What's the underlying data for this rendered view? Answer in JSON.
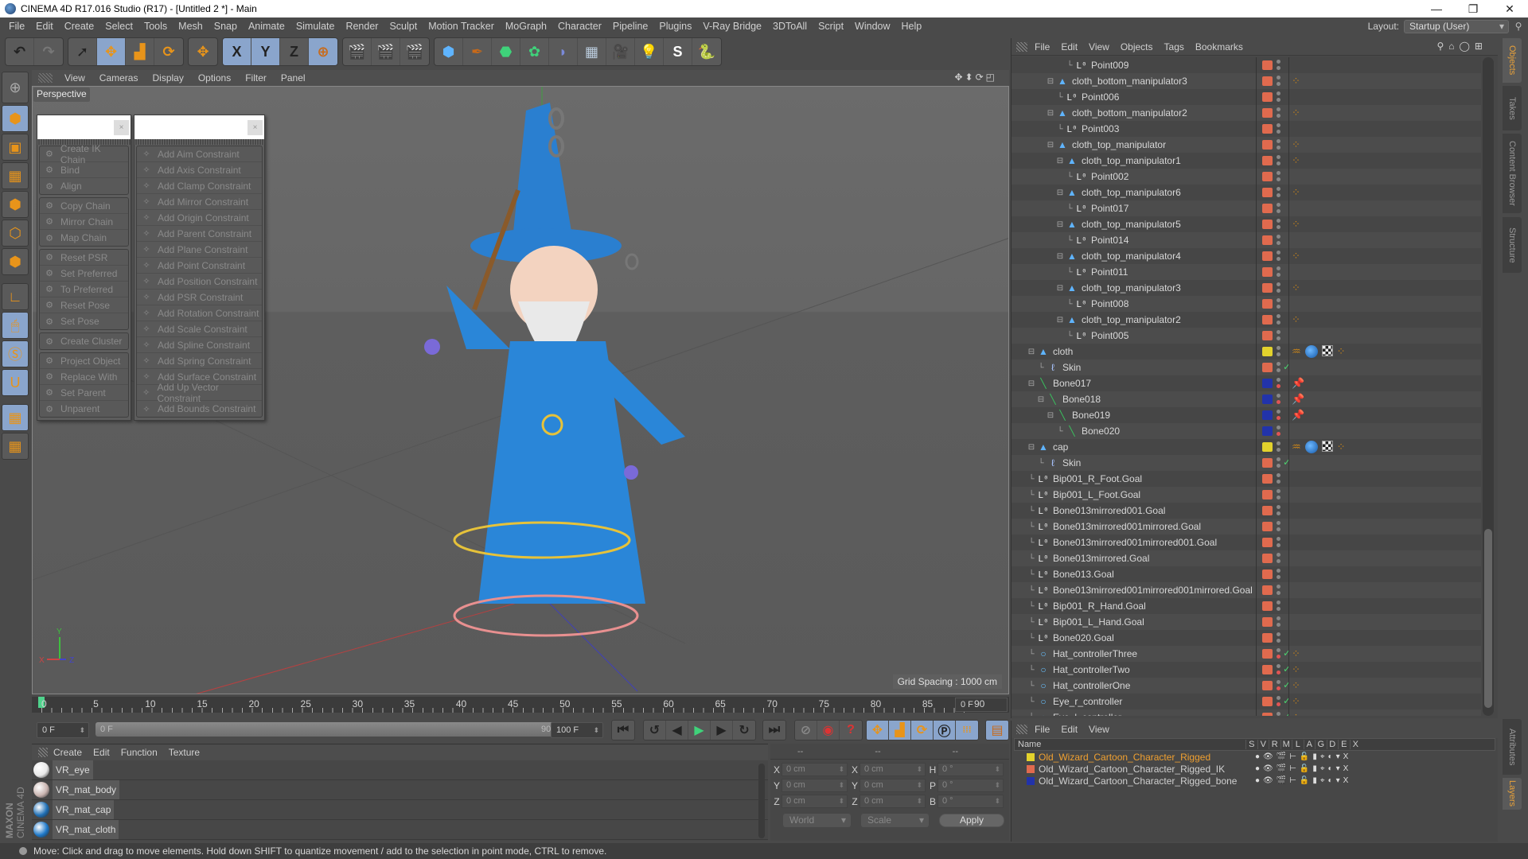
{
  "window": {
    "title": "CINEMA 4D R17.016 Studio (R17) - [Untitled 2 *] - Main",
    "controls": [
      "minimize-icon",
      "restore-icon",
      "close-icon"
    ]
  },
  "menubar": {
    "items": [
      "File",
      "Edit",
      "Create",
      "Select",
      "Tools",
      "Mesh",
      "Snap",
      "Animate",
      "Simulate",
      "Render",
      "Sculpt",
      "Motion Tracker",
      "MoGraph",
      "Character",
      "Pipeline",
      "Plugins",
      "V-Ray Bridge",
      "3DToAll",
      "Script",
      "Window",
      "Help"
    ],
    "layout_label": "Layout:",
    "layout_value": "Startup (User)"
  },
  "toolbar": {
    "groups": [
      [
        "undo-icon",
        "redo-icon"
      ],
      [
        "select-icon",
        "move-icon",
        "scale-icon",
        "rotate-icon"
      ],
      [
        "recent-tool-icon"
      ],
      [
        "x-axis-icon",
        "y-axis-icon",
        "z-axis-icon",
        "coordinate-system-icon"
      ],
      [
        "render-view-icon",
        "render-picture-viewer-icon",
        "render-settings-icon"
      ],
      [
        "cube-primitive-icon",
        "pen-spline-icon",
        "subdivision-icon",
        "array-icon",
        "deformer-icon",
        "floor-icon",
        "camera-icon",
        "light-icon",
        "vray-icon",
        "python-icon"
      ]
    ],
    "glyphs": [
      "↶",
      "↷",
      "➚",
      "✥",
      "▟",
      "⟳",
      "✥",
      "X",
      "Y",
      "Z",
      "⊕",
      "🎬",
      "🎬",
      "🎬",
      "⬢",
      "✒",
      "⬣",
      "✿",
      "◗",
      "▦",
      "🎥",
      "💡",
      "S",
      "🐍"
    ]
  },
  "left_tools": [
    "make-editable-icon",
    "model-mode-icon",
    "texture-mode-icon",
    "workplane-icon",
    "points-mode-icon",
    "edges-mode-icon",
    "polygons-mode-icon",
    "axis-mode-icon",
    "tweak-mode-icon",
    "solo-icon",
    "snap-icon",
    "workplane-lock-icon",
    "workplane-align-icon"
  ],
  "viewport": {
    "menu": [
      "View",
      "Cameras",
      "Display",
      "Options",
      "Filter",
      "Panel"
    ],
    "label": "Perspective",
    "grid_spacing": "Grid Spacing : 1000 cm",
    "axes": {
      "x": "X",
      "y": "Y",
      "z": "Z"
    }
  },
  "character_menu": {
    "groups": [
      [
        "Create IK Chain",
        "Bind",
        "Align"
      ],
      [
        "Copy Chain",
        "Mirror Chain",
        "Map Chain"
      ],
      [
        "Reset PSR",
        "Set Preferred",
        "To Preferred",
        "Reset Pose",
        "Set Pose"
      ],
      [
        "Create Cluster"
      ],
      [
        "Project Object",
        "Replace With",
        "Set Parent",
        "Unparent"
      ]
    ]
  },
  "constraint_menu": {
    "items": [
      "Add Aim Constraint",
      "Add Axis Constraint",
      "Add Clamp Constraint",
      "Add Mirror Constraint",
      "Add Origin Constraint",
      "Add Parent Constraint",
      "Add Plane Constraint",
      "Add Point Constraint",
      "Add Position Constraint",
      "Add PSR Constraint",
      "Add Rotation Constraint",
      "Add Scale Constraint",
      "Add Spline Constraint",
      "Add Spring Constraint",
      "Add Surface Constraint",
      "Add Up Vector Constraint",
      "Add Bounds Constraint"
    ]
  },
  "timeline": {
    "ticks": [
      "0",
      "5",
      "10",
      "15",
      "20",
      "25",
      "30",
      "35",
      "40",
      "45",
      "50",
      "55",
      "60",
      "65",
      "70",
      "75",
      "80",
      "85",
      "90"
    ],
    "current_frame": "0 F",
    "start_field": "0 F",
    "range_start": "0 F",
    "range_end": "90 F",
    "end_field": "100 F",
    "current_frame_position": 0
  },
  "playback": {
    "buttons": [
      "go-to-start-icon",
      "previous-key-icon",
      "previous-frame-icon",
      "play-icon",
      "next-frame-icon",
      "next-key-icon",
      "go-to-end-icon"
    ],
    "key_buttons": [
      "motion-record-icon",
      "record-active-icon",
      "autokey-icon"
    ],
    "track_buttons": [
      "key-position-icon",
      "key-scale-icon",
      "key-rotation-icon",
      "key-parameter-icon",
      "key-pla-icon"
    ],
    "timeline_button": "timeline-icon"
  },
  "materials": {
    "menu": [
      "Create",
      "Edit",
      "Function",
      "Texture"
    ],
    "items": [
      {
        "name": "VR_eye",
        "color": "#e8e8e8"
      },
      {
        "name": "VR_mat_body",
        "color": "#c9b4b0"
      },
      {
        "name": "VR_mat_cap",
        "color": "#1f6fb5"
      },
      {
        "name": "VR_mat_cloth",
        "color": "#1e78c8"
      }
    ]
  },
  "coordinates": {
    "headers": [
      "--",
      "--",
      "--"
    ],
    "rows": [
      {
        "l1": "X",
        "v1": "0 cm",
        "l2": "X",
        "v2": "0 cm",
        "l3": "H",
        "v3": "0 °"
      },
      {
        "l1": "Y",
        "v1": "0 cm",
        "l2": "Y",
        "v2": "0 cm",
        "l3": "P",
        "v3": "0 °"
      },
      {
        "l1": "Z",
        "v1": "0 cm",
        "l2": "Z",
        "v2": "0 cm",
        "l3": "B",
        "v3": "0 °"
      }
    ],
    "space": "World",
    "mode": "Scale",
    "apply": "Apply"
  },
  "objects": {
    "menu": [
      "File",
      "Edit",
      "View",
      "Objects",
      "Tags",
      "Bookmarks"
    ],
    "rows": [
      {
        "name": "Point009",
        "icon": "null",
        "depth": 4,
        "color": "#e06a4e",
        "exp": "",
        "tags": []
      },
      {
        "name": "cloth_bottom_manipulator3",
        "icon": "tri",
        "depth": 2,
        "color": "#e06a4e",
        "exp": "⊟",
        "tags": [
          "ik"
        ]
      },
      {
        "name": "Point006",
        "icon": "null",
        "depth": 3,
        "color": "#e06a4e",
        "exp": "",
        "tags": []
      },
      {
        "name": "cloth_bottom_manipulator2",
        "icon": "tri",
        "depth": 2,
        "color": "#e06a4e",
        "exp": "⊟",
        "tags": [
          "ik"
        ]
      },
      {
        "name": "Point003",
        "icon": "null",
        "depth": 3,
        "color": "#e06a4e",
        "exp": "",
        "tags": []
      },
      {
        "name": "cloth_top_manipulator",
        "icon": "tri",
        "depth": 2,
        "color": "#e06a4e",
        "exp": "⊟",
        "tags": [
          "ik"
        ]
      },
      {
        "name": "cloth_top_manipulator1",
        "icon": "tri",
        "depth": 3,
        "color": "#e06a4e",
        "exp": "⊟",
        "tags": [
          "ik"
        ]
      },
      {
        "name": "Point002",
        "icon": "null",
        "depth": 4,
        "color": "#e06a4e",
        "exp": "",
        "tags": []
      },
      {
        "name": "cloth_top_manipulator6",
        "icon": "tri",
        "depth": 3,
        "color": "#e06a4e",
        "exp": "⊟",
        "tags": [
          "ik"
        ]
      },
      {
        "name": "Point017",
        "icon": "null",
        "depth": 4,
        "color": "#e06a4e",
        "exp": "",
        "tags": []
      },
      {
        "name": "cloth_top_manipulator5",
        "icon": "tri",
        "depth": 3,
        "color": "#e06a4e",
        "exp": "⊟",
        "tags": [
          "ik"
        ]
      },
      {
        "name": "Point014",
        "icon": "null",
        "depth": 4,
        "color": "#e06a4e",
        "exp": "",
        "tags": []
      },
      {
        "name": "cloth_top_manipulator4",
        "icon": "tri",
        "depth": 3,
        "color": "#e06a4e",
        "exp": "⊟",
        "tags": [
          "ik"
        ]
      },
      {
        "name": "Point011",
        "icon": "null",
        "depth": 4,
        "color": "#e06a4e",
        "exp": "",
        "tags": []
      },
      {
        "name": "cloth_top_manipulator3",
        "icon": "tri",
        "depth": 3,
        "color": "#e06a4e",
        "exp": "⊟",
        "tags": [
          "ik"
        ]
      },
      {
        "name": "Point008",
        "icon": "null",
        "depth": 4,
        "color": "#e06a4e",
        "exp": "",
        "tags": []
      },
      {
        "name": "cloth_top_manipulator2",
        "icon": "tri",
        "depth": 3,
        "color": "#e06a4e",
        "exp": "⊟",
        "tags": [
          "ik"
        ]
      },
      {
        "name": "Point005",
        "icon": "null",
        "depth": 4,
        "color": "#e06a4e",
        "exp": "",
        "tags": []
      },
      {
        "name": "cloth",
        "icon": "tri",
        "depth": 0,
        "color": "#e3d22c",
        "exp": "⊟",
        "tags": [
          "weight",
          "mat",
          "uvw",
          "ik"
        ]
      },
      {
        "name": "Skin",
        "icon": "skin",
        "depth": 1,
        "color": "#e06a4e",
        "exp": "",
        "tags": [],
        "check": true
      },
      {
        "name": "Bone017",
        "icon": "bone",
        "depth": 0,
        "color": "#2233aa",
        "exp": "⊟",
        "tags": [
          "pin"
        ],
        "red": true
      },
      {
        "name": "Bone018",
        "icon": "bone",
        "depth": 1,
        "color": "#2233aa",
        "exp": "⊟",
        "tags": [
          "pin"
        ],
        "red": true
      },
      {
        "name": "Bone019",
        "icon": "bone",
        "depth": 2,
        "color": "#2233aa",
        "exp": "⊟",
        "tags": [
          "pin"
        ],
        "red": true
      },
      {
        "name": "Bone020",
        "icon": "bone",
        "depth": 3,
        "color": "#2233aa",
        "exp": "",
        "tags": [],
        "red": true
      },
      {
        "name": "cap",
        "icon": "tri",
        "depth": 0,
        "color": "#e3d22c",
        "exp": "⊟",
        "tags": [
          "weight",
          "mat",
          "uvw",
          "ik"
        ]
      },
      {
        "name": "Skin",
        "icon": "skin",
        "depth": 1,
        "color": "#e06a4e",
        "exp": "",
        "tags": [],
        "check": true
      },
      {
        "name": "Bip001_R_Foot.Goal",
        "icon": "null",
        "depth": 0,
        "color": "#e06a4e",
        "exp": "",
        "tags": []
      },
      {
        "name": "Bip001_L_Foot.Goal",
        "icon": "null",
        "depth": 0,
        "color": "#e06a4e",
        "exp": "",
        "tags": []
      },
      {
        "name": "Bone013mirrored001.Goal",
        "icon": "null",
        "depth": 0,
        "color": "#e06a4e",
        "exp": "",
        "tags": []
      },
      {
        "name": "Bone013mirrored001mirrored.Goal",
        "icon": "null",
        "depth": 0,
        "color": "#e06a4e",
        "exp": "",
        "tags": []
      },
      {
        "name": "Bone013mirrored001mirrored001.Goal",
        "icon": "null",
        "depth": 0,
        "color": "#e06a4e",
        "exp": "",
        "tags": []
      },
      {
        "name": "Bone013mirrored.Goal",
        "icon": "null",
        "depth": 0,
        "color": "#e06a4e",
        "exp": "",
        "tags": []
      },
      {
        "name": "Bone013.Goal",
        "icon": "null",
        "depth": 0,
        "color": "#e06a4e",
        "exp": "",
        "tags": []
      },
      {
        "name": "Bone013mirrored001mirrored001mirrored.Goal",
        "icon": "null",
        "depth": 0,
        "color": "#e06a4e",
        "exp": "",
        "tags": []
      },
      {
        "name": "Bip001_R_Hand.Goal",
        "icon": "null",
        "depth": 0,
        "color": "#e06a4e",
        "exp": "",
        "tags": []
      },
      {
        "name": "Bip001_L_Hand.Goal",
        "icon": "null",
        "depth": 0,
        "color": "#e06a4e",
        "exp": "",
        "tags": []
      },
      {
        "name": "Bone020.Goal",
        "icon": "null",
        "depth": 0,
        "color": "#e06a4e",
        "exp": "",
        "tags": []
      },
      {
        "name": "Hat_controllerThree",
        "icon": "circ",
        "depth": 0,
        "color": "#e06a4e",
        "exp": "",
        "tags": [
          "ik"
        ],
        "check": true,
        "red": true
      },
      {
        "name": "Hat_controllerTwo",
        "icon": "circ",
        "depth": 0,
        "color": "#e06a4e",
        "exp": "",
        "tags": [
          "ik"
        ],
        "check": true,
        "red": true
      },
      {
        "name": "Hat_controllerOne",
        "icon": "circ",
        "depth": 0,
        "color": "#e06a4e",
        "exp": "",
        "tags": [
          "ik"
        ],
        "check": true,
        "red": true
      },
      {
        "name": "Eye_r_controller",
        "icon": "circ",
        "depth": 0,
        "color": "#e06a4e",
        "exp": "",
        "tags": [
          "ik"
        ],
        "check": true,
        "red": true
      },
      {
        "name": "Eye_l_controller",
        "icon": "circ",
        "depth": 0,
        "color": "#e06a4e",
        "exp": "",
        "tags": [
          "ik"
        ],
        "check": true,
        "red": true
      }
    ]
  },
  "side_tabs_top": [
    "Objects",
    "Takes",
    "Content Browser",
    "Structure"
  ],
  "side_tabs_bottom": [
    "Attributes",
    "Layers"
  ],
  "layers": {
    "menu": [
      "File",
      "Edit",
      "View"
    ],
    "columns": [
      "Name",
      "S",
      "V",
      "R",
      "M",
      "L",
      "A",
      "G",
      "D",
      "E",
      "X"
    ],
    "rows": [
      {
        "name": "Old_Wizard_Cartoon_Character_Rigged",
        "color": "#e3d22c",
        "active": true
      },
      {
        "name": "Old_Wizard_Cartoon_Character_Rigged_IK",
        "color": "#e06a4e",
        "active": false
      },
      {
        "name": "Old_Wizard_Cartoon_Character_Rigged_bone",
        "color": "#2233aa",
        "active": false
      }
    ]
  },
  "status": {
    "text": "Move: Click and drag to move elements. Hold down SHIFT to quantize movement / add to the selection in point mode, CTRL to remove."
  },
  "branding": {
    "line1": "MAXON",
    "line2": "CINEMA 4D"
  }
}
